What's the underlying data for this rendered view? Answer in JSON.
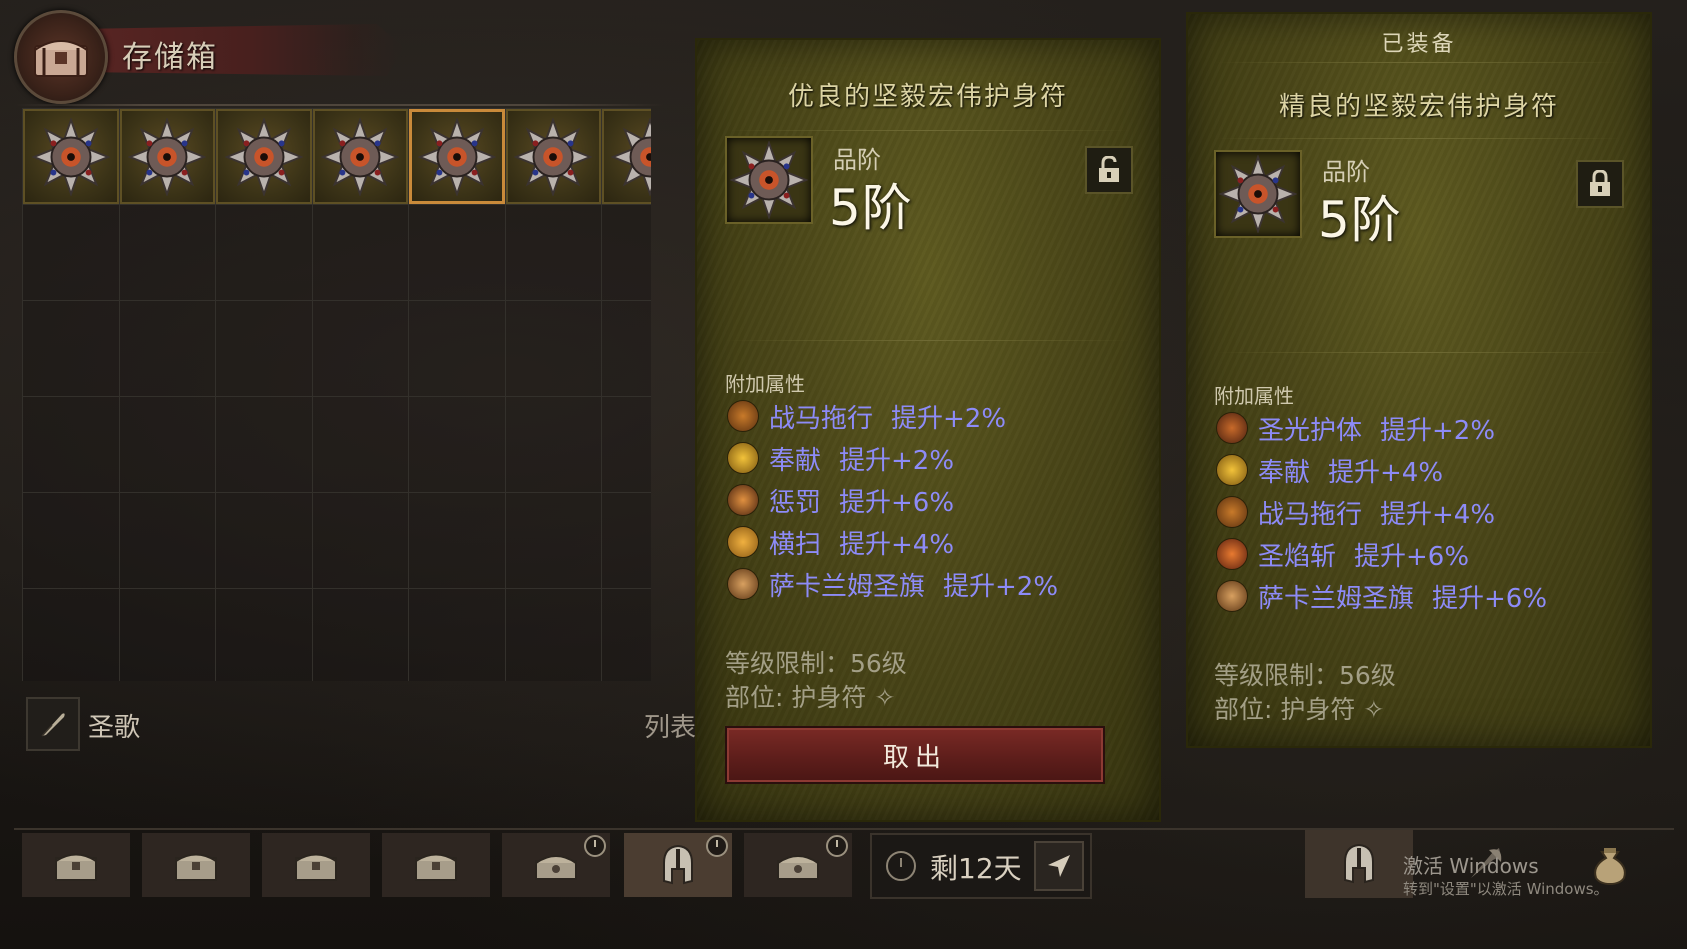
{
  "stash": {
    "title": "存储箱"
  },
  "bottom": {
    "hymn_label": "圣歌",
    "list_label": "列表"
  },
  "timer": {
    "text": "剩12天"
  },
  "watermark": {
    "line1": "激活 Windows",
    "line2": "转到\"设置\"以激活 Windows。"
  },
  "selected_item": {
    "name": "优良的坚毅宏伟护身符",
    "grade_label": "品阶",
    "grade_value": "5阶",
    "attr_header": "附加属性",
    "attributes": [
      {
        "icon": "horse-drag-icon",
        "name": "战马拖行",
        "bonus": "提升+2%",
        "color": "#7a4a1e"
      },
      {
        "icon": "devotion-icon",
        "name": "奉献",
        "bonus": "提升+2%",
        "color": "#c8961e"
      },
      {
        "icon": "punish-icon",
        "name": "惩罚",
        "bonus": "提升+6%",
        "color": "#b86a1e"
      },
      {
        "icon": "sweep-icon",
        "name": "横扫",
        "bonus": "提升+4%",
        "color": "#d79a2a"
      },
      {
        "icon": "banner-icon",
        "name": "萨卡兰姆圣旗",
        "bonus": "提升+2%",
        "color": "#8a5a2a"
      }
    ],
    "level_req": "等级限制：56级",
    "slot": "部位: 护身符",
    "take_button": "取出"
  },
  "equipped_item": {
    "header": "已装备",
    "name": "精良的坚毅宏伟护身符",
    "grade_label": "品阶",
    "grade_value": "5阶",
    "attr_header": "附加属性",
    "attributes": [
      {
        "icon": "holy-shield-icon",
        "name": "圣光护体",
        "bonus": "提升+2%",
        "color": "#8a4a1e"
      },
      {
        "icon": "devotion-icon",
        "name": "奉献",
        "bonus": "提升+4%",
        "color": "#c8961e"
      },
      {
        "icon": "horse-drag-icon",
        "name": "战马拖行",
        "bonus": "提升+4%",
        "color": "#7a4a1e"
      },
      {
        "icon": "flame-slash-icon",
        "name": "圣焰斩",
        "bonus": "提升+6%",
        "color": "#b8561e"
      },
      {
        "icon": "banner-icon",
        "name": "萨卡兰姆圣旗",
        "bonus": "提升+6%",
        "color": "#8a5a2a"
      }
    ],
    "level_req": "等级限制：56级",
    "slot": "部位: 护身符"
  },
  "colors": {
    "attribute_text": "#8d8bf7",
    "panel_bg": "#4a4618",
    "button_red": "#6b2420",
    "selected_border": "#c98a3a"
  }
}
